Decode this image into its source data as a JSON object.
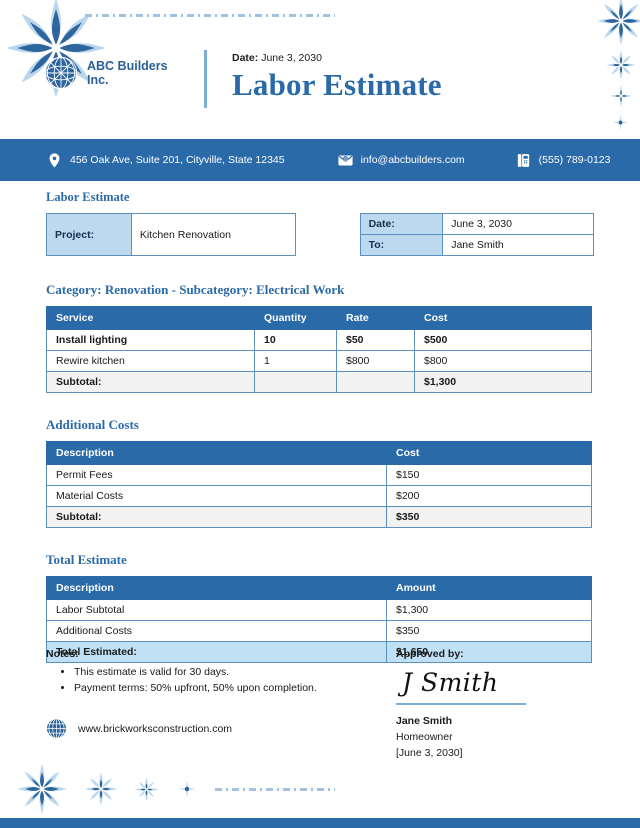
{
  "header": {
    "company_name": "ABC Builders Inc.",
    "logo_icon": "globe-sphere-icon",
    "date_label": "Date:",
    "date_value": "June 3, 2030",
    "doc_title": "Labor Estimate"
  },
  "contact_bar": {
    "address_icon": "location-pin-icon",
    "address": "456 Oak Ave, Suite 201, Cityville, State 12345",
    "email_icon": "envelope-icon",
    "email": "info@abcbuilders.com",
    "phone_icon": "desk-phone-icon",
    "phone": "(555) 789-0123"
  },
  "meta": {
    "section_title": "Labor Estimate",
    "project_label": "Project:",
    "project_value": "Kitchen Renovation",
    "date_label": "Date:",
    "date_value": "June 3, 2030",
    "to_label": "To:",
    "to_value": "Jane Smith"
  },
  "labor": {
    "section_title": "Category: Renovation - Subcategory: Electrical Work",
    "columns": [
      "Service",
      "Quantity",
      "Rate",
      "Cost"
    ],
    "rows": [
      {
        "service": "Install lighting",
        "quantity": "10",
        "rate": "$50",
        "cost": "$500"
      },
      {
        "service": "Rewire kitchen",
        "quantity": "1",
        "rate": "$800",
        "cost": "$800"
      }
    ],
    "subtotal_label": "Subtotal:",
    "subtotal_quantity": "",
    "subtotal_rate": "",
    "subtotal_cost": "$1,300"
  },
  "additional": {
    "section_title": "Additional Costs",
    "columns": [
      "Description",
      "Cost"
    ],
    "rows": [
      {
        "description": "Permit Fees",
        "cost": "$150"
      },
      {
        "description": "Material Costs",
        "cost": "$200"
      }
    ],
    "subtotal_label": "Subtotal:",
    "subtotal_cost": "$350"
  },
  "total": {
    "section_title": "Total Estimate",
    "columns": [
      "Description",
      "Amount"
    ],
    "rows": [
      {
        "description": "Labor Subtotal",
        "amount": "$1,300"
      },
      {
        "description": "Additional Costs",
        "amount": "$350"
      }
    ],
    "total_label": "Total Estimated:",
    "total_amount": "$1,650"
  },
  "footer": {
    "notes_heading": "Notes:",
    "notes": [
      "This estimate is valid for 30 days.",
      "Payment terms: 50% upfront, 50% upon completion."
    ],
    "website_icon": "globe-grid-icon",
    "website": "www.brickworksconstruction.com",
    "approved_heading": "Approved by:",
    "signature": "J Smith",
    "signer_name": "Jane Smith",
    "signer_role": "Homeowner",
    "signer_date": "[June 3, 2030]"
  },
  "colors": {
    "brand_blue": "#2a6aa8",
    "light_blue": "#bcd9ef",
    "highlight_blue": "#bfe0f5",
    "subtotal_gray": "#f2f2f2",
    "border_blue": "#5b8fbe",
    "star_light": "#bad6ec",
    "star_dark": "#2f659d"
  }
}
